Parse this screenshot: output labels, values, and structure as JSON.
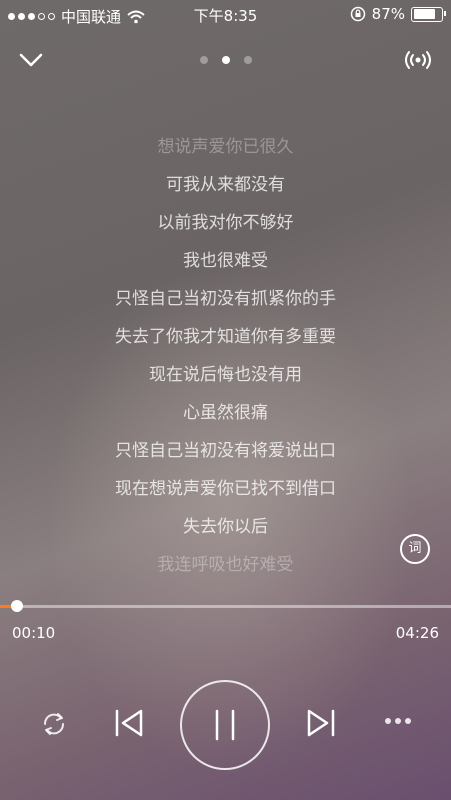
{
  "status_bar": {
    "signal_filled": 3,
    "signal_total": 5,
    "carrier": "中国联通",
    "time": "下午8:35",
    "battery_text": "87%",
    "battery_level": 0.87
  },
  "header": {
    "pages_total": 3,
    "active_page": 2
  },
  "lyrics": [
    "想说声爱你已很久",
    "可我从来都没有",
    "以前我对你不够好",
    "我也很难受",
    "只怪自己当初没有抓紧你的手",
    "失去了你我才知道你有多重要",
    "现在说后悔也没有用",
    "心虽然很痛",
    "只怪自己当初没有将爱说出口",
    "现在想说声爱你已找不到借口",
    "失去你以后",
    "我连呼吸也好难受"
  ],
  "lyric_button_label": "词",
  "player": {
    "current_time": "00:10",
    "total_time": "04:26",
    "progress": 0.038,
    "accent_color": "#ff7a1a"
  },
  "icons": {
    "collapse": "chevron-down-icon",
    "broadcast": "broadcast-icon",
    "repeat": "repeat-icon",
    "previous": "previous-icon",
    "pause": "pause-icon",
    "next": "next-icon",
    "more": "more-icon"
  }
}
